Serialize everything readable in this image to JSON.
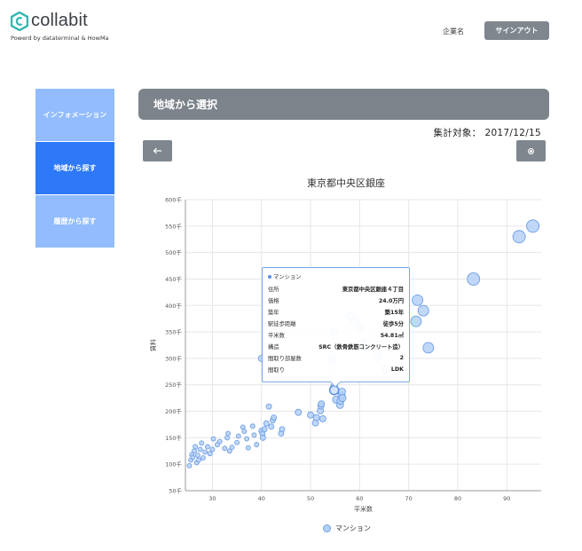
{
  "brand": {
    "logo_text": "collabit",
    "tagline": "Powerd by dataterminal & HowMa",
    "accent_color": "#2fb7b0"
  },
  "header": {
    "company_label": "企業名",
    "signout_label": "サインアウト"
  },
  "sidebar": {
    "items": [
      {
        "label": "インフォメーション",
        "active": false
      },
      {
        "label": "地域から探す",
        "active": true
      },
      {
        "label": "履歴から探す",
        "active": false
      }
    ],
    "active_color": "#2e79f8",
    "inactive_color": "#92bcfd"
  },
  "main": {
    "section_title": "地域から選択",
    "period_label": "集計対象：",
    "period_value": "2017/12/15",
    "back_icon": "arrow-left-icon",
    "reset_icon": "radio-dot-icon"
  },
  "chart_data": {
    "type": "scatter",
    "title": "東京都中央区銀座",
    "xlabel": "平米数",
    "ylabel": "賃料",
    "xlim": [
      24.5,
      97
    ],
    "ylim": [
      50,
      600
    ],
    "x_ticks": [
      30,
      40,
      50,
      60,
      70,
      80,
      90
    ],
    "y_ticks": [
      "50千",
      "100千",
      "150千",
      "200千",
      "250千",
      "300千",
      "350千",
      "400千",
      "450千",
      "500千",
      "550千",
      "600千"
    ],
    "y_tick_values": [
      50,
      100,
      150,
      200,
      250,
      300,
      350,
      400,
      450,
      500,
      550,
      600
    ],
    "grid": true,
    "legend_position": "bottom",
    "series": [
      {
        "name": "マンション",
        "fill": "#b5d0f7",
        "stroke": "#6f9fe5",
        "points": [
          {
            "x": 25.3,
            "y": 97,
            "r": 2.5
          },
          {
            "x": 25.6,
            "y": 108,
            "r": 2.5
          },
          {
            "x": 25.8,
            "y": 118,
            "r": 2.5
          },
          {
            "x": 26.0,
            "y": 113,
            "r": 2.5
          },
          {
            "x": 26.3,
            "y": 125,
            "r": 2.5
          },
          {
            "x": 26.5,
            "y": 133,
            "r": 2.5
          },
          {
            "x": 26.8,
            "y": 103,
            "r": 2.5
          },
          {
            "x": 27.0,
            "y": 117,
            "r": 2.5
          },
          {
            "x": 27.2,
            "y": 108,
            "r": 2.5
          },
          {
            "x": 27.5,
            "y": 128,
            "r": 2.5
          },
          {
            "x": 27.8,
            "y": 140,
            "r": 2.5
          },
          {
            "x": 28.1,
            "y": 112,
            "r": 2.5
          },
          {
            "x": 28.5,
            "y": 123,
            "r": 2.5
          },
          {
            "x": 29.0,
            "y": 133,
            "r": 2.5
          },
          {
            "x": 29.5,
            "y": 120,
            "r": 2.5
          },
          {
            "x": 30.0,
            "y": 128,
            "r": 2.5
          },
          {
            "x": 30.2,
            "y": 148,
            "r": 2.5
          },
          {
            "x": 31.0,
            "y": 137,
            "r": 2.5
          },
          {
            "x": 31.5,
            "y": 143,
            "r": 2.5
          },
          {
            "x": 32.5,
            "y": 130,
            "r": 2.5
          },
          {
            "x": 33.0,
            "y": 150,
            "r": 2.5
          },
          {
            "x": 33.2,
            "y": 158,
            "r": 2.5
          },
          {
            "x": 33.5,
            "y": 125,
            "r": 2.5
          },
          {
            "x": 34.0,
            "y": 132,
            "r": 2.5
          },
          {
            "x": 35.0,
            "y": 141,
            "r": 2.5
          },
          {
            "x": 35.3,
            "y": 153,
            "r": 2.5
          },
          {
            "x": 36.2,
            "y": 170,
            "r": 2.5
          },
          {
            "x": 36.5,
            "y": 162,
            "r": 2.5
          },
          {
            "x": 37.0,
            "y": 148,
            "r": 2.5
          },
          {
            "x": 37.3,
            "y": 131,
            "r": 2.5
          },
          {
            "x": 38.2,
            "y": 172,
            "r": 2.5
          },
          {
            "x": 38.5,
            "y": 155,
            "r": 2.5
          },
          {
            "x": 39.0,
            "y": 137,
            "r": 2.5
          },
          {
            "x": 40.0,
            "y": 163,
            "r": 3
          },
          {
            "x": 40.2,
            "y": 158,
            "r": 3
          },
          {
            "x": 40.3,
            "y": 150,
            "r": 3
          },
          {
            "x": 40.6,
            "y": 166,
            "r": 3
          },
          {
            "x": 41.0,
            "y": 177,
            "r": 3
          },
          {
            "x": 41.5,
            "y": 209,
            "r": 3
          },
          {
            "x": 42.0,
            "y": 171,
            "r": 3
          },
          {
            "x": 42.3,
            "y": 183,
            "r": 3
          },
          {
            "x": 42.5,
            "y": 188,
            "r": 3
          },
          {
            "x": 44.0,
            "y": 158,
            "r": 3
          },
          {
            "x": 44.2,
            "y": 166,
            "r": 3
          },
          {
            "x": 47.5,
            "y": 198,
            "r": 3.5
          },
          {
            "x": 50.0,
            "y": 193,
            "r": 3.5
          },
          {
            "x": 51.0,
            "y": 178,
            "r": 3.5
          },
          {
            "x": 51.2,
            "y": 188,
            "r": 3.5
          },
          {
            "x": 52.0,
            "y": 201,
            "r": 3.5
          },
          {
            "x": 52.1,
            "y": 210,
            "r": 3.5
          },
          {
            "x": 52.2,
            "y": 214,
            "r": 3.5
          },
          {
            "x": 52.5,
            "y": 186,
            "r": 3.5
          },
          {
            "x": 54.6,
            "y": 240,
            "r": 4
          },
          {
            "x": 54.8,
            "y": 246,
            "r": 4
          },
          {
            "x": 55.2,
            "y": 222,
            "r": 4
          },
          {
            "x": 56.0,
            "y": 212,
            "r": 4
          },
          {
            "x": 56.1,
            "y": 220,
            "r": 4
          },
          {
            "x": 56.3,
            "y": 230,
            "r": 4
          },
          {
            "x": 56.4,
            "y": 237,
            "r": 4
          },
          {
            "x": 56.5,
            "y": 225,
            "r": 4
          },
          {
            "x": 54.0,
            "y": 262,
            "r": 3.5
          },
          {
            "x": 54.3,
            "y": 295,
            "r": 3.5
          },
          {
            "x": 54.5,
            "y": 302,
            "r": 3.5
          },
          {
            "x": 54.8,
            "y": 350,
            "r": 3.5
          },
          {
            "x": 40.0,
            "y": 300,
            "r": 3.5
          },
          {
            "x": 58.0,
            "y": 380,
            "r": 4.5
          },
          {
            "x": 59.0,
            "y": 372,
            "r": 4.5
          },
          {
            "x": 60.0,
            "y": 358,
            "r": 4.5
          },
          {
            "x": 60.5,
            "y": 330,
            "r": 4.5
          },
          {
            "x": 61.0,
            "y": 322,
            "r": 4.5
          },
          {
            "x": 63.5,
            "y": 303,
            "r": 4.5
          },
          {
            "x": 65.5,
            "y": 280,
            "r": 4.5
          },
          {
            "x": 71.8,
            "y": 410,
            "r": 6
          },
          {
            "x": 73.0,
            "y": 390,
            "r": 6
          },
          {
            "x": 71.5,
            "y": 370,
            "r": 6
          },
          {
            "x": 74.0,
            "y": 320,
            "r": 6
          },
          {
            "x": 83.2,
            "y": 450,
            "r": 7
          },
          {
            "x": 92.5,
            "y": 530,
            "r": 7
          },
          {
            "x": 95.3,
            "y": 550,
            "r": 7
          }
        ],
        "highlighted": {
          "x": 54.81,
          "y": 240
        }
      }
    ],
    "tooltip": {
      "series_name": "マンション",
      "rows": [
        {
          "label": "住所",
          "value": "東京都中央区銀座４丁目"
        },
        {
          "label": "価格",
          "value": "24.0万円"
        },
        {
          "label": "築年",
          "value": "築15年"
        },
        {
          "label": "駅徒歩距離",
          "value": "徒歩5分"
        },
        {
          "label": "平米数",
          "value": "54.81㎡"
        },
        {
          "label": "構造",
          "value": "SRC（鉄骨鉄筋コンクリート造）"
        },
        {
          "label": "間取り部屋数",
          "value": "2"
        },
        {
          "label": "間取り",
          "value": "LDK"
        }
      ]
    }
  }
}
